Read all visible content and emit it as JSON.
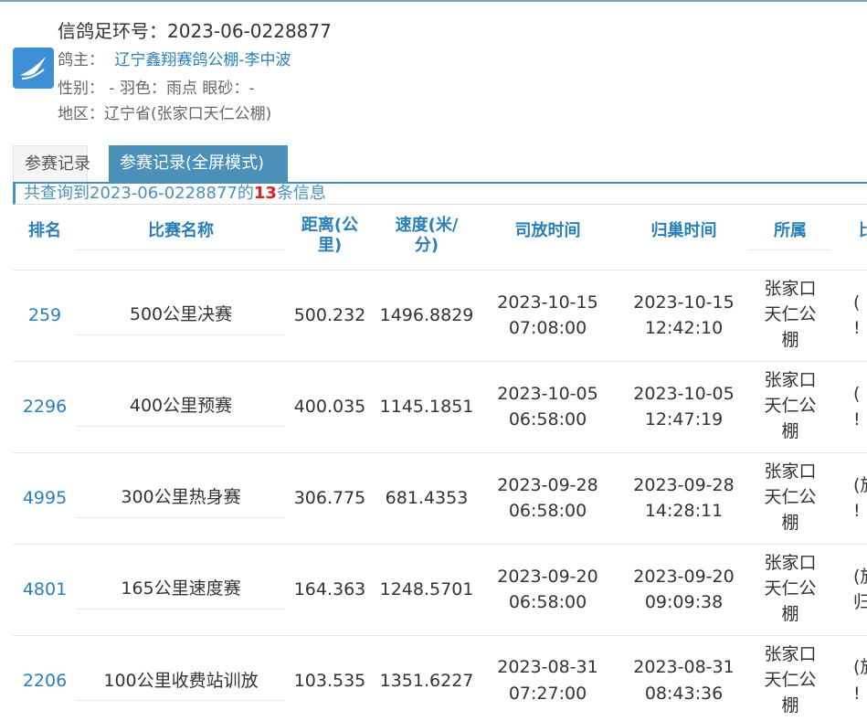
{
  "header": {
    "ring_label": "信鸽足环号：",
    "ring_number": "2023-06-0228877",
    "owner_label": "鸽主：",
    "owner": "辽宁鑫翔赛鸽公棚-李中波",
    "gender_label": "性别：",
    "gender": "-",
    "feather_label": "羽色：",
    "feather": "雨点",
    "eye_label": "眼砂：",
    "eye": "-",
    "region_label": "地区：",
    "region": "辽宁省(张家口天仁公棚)"
  },
  "tabs": [
    "参赛记录",
    "参赛记录(全屏模式)"
  ],
  "summary": {
    "prefix": "共查询到2023-06-0228877的",
    "count": "13",
    "suffix": "条信息"
  },
  "table": {
    "headers": [
      "排名",
      "比赛名称",
      "距离(公\n里)",
      "速度(米/\n分)",
      "司放时间",
      "归巢时间",
      "所属",
      "比"
    ],
    "rows": [
      {
        "rank": "259",
        "race": "500公里决赛",
        "distance": "500.232",
        "speed": "1496.8829",
        "release_date": "2023-10-15",
        "release_time": "07:08:00",
        "return_date": "2023-10-15",
        "return_time": "12:42:10",
        "owner_l1": "张家口",
        "owner_l2": "天仁公",
        "owner_l3": "棚",
        "clip_l1": "(",
        "clip_l2": "!"
      },
      {
        "rank": "2296",
        "race": "400公里预赛",
        "distance": "400.035",
        "speed": "1145.1851",
        "release_date": "2023-10-05",
        "release_time": "06:58:00",
        "return_date": "2023-10-05",
        "return_time": "12:47:19",
        "owner_l1": "张家口",
        "owner_l2": "天仁公",
        "owner_l3": "棚",
        "clip_l1": "(",
        "clip_l2": "!"
      },
      {
        "rank": "4995",
        "race": "300公里热身赛",
        "distance": "306.775",
        "speed": "681.4353",
        "release_date": "2023-09-28",
        "release_time": "06:58:00",
        "return_date": "2023-09-28",
        "return_time": "14:28:11",
        "owner_l1": "张家口",
        "owner_l2": "天仁公",
        "owner_l3": "棚",
        "clip_l1": "(旅",
        "clip_l2": "!"
      },
      {
        "rank": "4801",
        "race": "165公里速度赛",
        "distance": "164.363",
        "speed": "1248.5701",
        "release_date": "2023-09-20",
        "release_time": "06:58:00",
        "return_date": "2023-09-20",
        "return_time": "09:09:38",
        "owner_l1": "张家口",
        "owner_l2": "天仁公",
        "owner_l3": "棚",
        "clip_l1": "(旅",
        "clip_l2": "归"
      },
      {
        "rank": "2206",
        "race": "100公里收费站训放",
        "distance": "103.535",
        "speed": "1351.6227",
        "release_date": "2023-08-31",
        "release_time": "07:27:00",
        "return_date": "2023-08-31",
        "return_time": "08:43:36",
        "owner_l1": "张家口",
        "owner_l2": "天仁公",
        "owner_l3": "棚",
        "clip_l1": "(旅",
        "clip_l2": "!"
      }
    ]
  },
  "colors": {
    "accent": "#4a90b8",
    "link": "#2a7fb8",
    "count": "#e02020",
    "logo": "#3d8fd6"
  },
  "icons": {
    "logo": "pigeon-logo-icon"
  }
}
